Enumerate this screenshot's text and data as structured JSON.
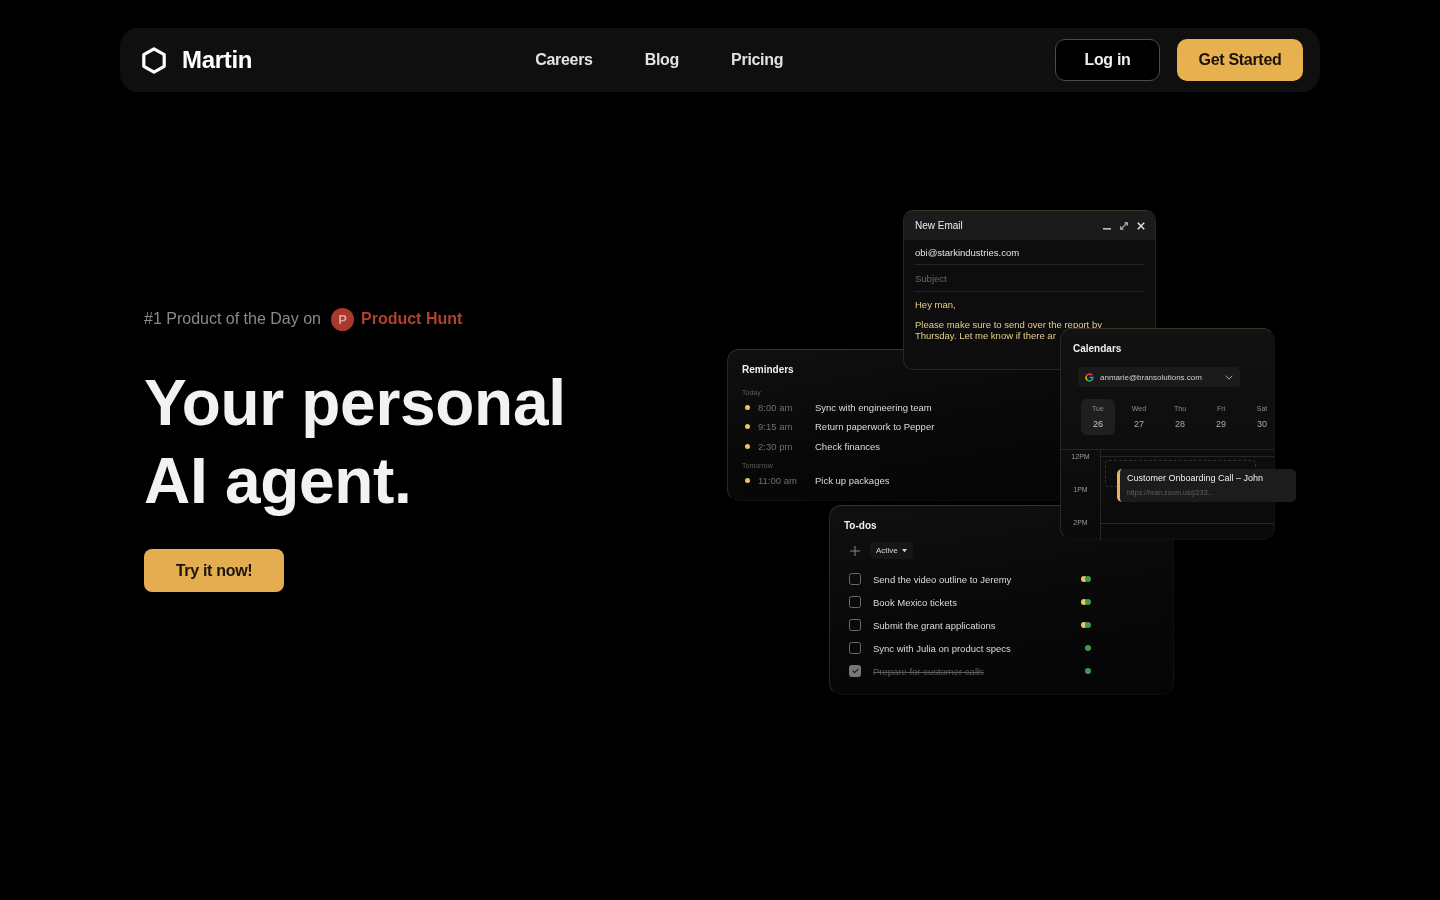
{
  "nav": {
    "brand": "Martin",
    "links": [
      {
        "label": "Careers"
      },
      {
        "label": "Blog"
      },
      {
        "label": "Pricing"
      }
    ],
    "buttons": [
      {
        "label": "Log in",
        "kind": "outline"
      },
      {
        "label": "Get Started",
        "kind": "primary"
      }
    ]
  },
  "hero": {
    "award": {
      "text": "#1 Product of the Day on",
      "logo_letter": "P",
      "name": "Product Hunt"
    },
    "title": "Your personal AI agent.",
    "cta": "Try it now!"
  },
  "email": {
    "title": "New Email",
    "to": {
      "value": "obi@starkindustries.com"
    },
    "subject": {
      "placeholder": "Subject"
    },
    "body": [
      "Hey man,",
      "Please make sure to send over the report by Thursday. Let me know if there ar"
    ]
  },
  "reminders": {
    "title": "Reminders",
    "groups": [
      {
        "label": "Today",
        "items": [
          {
            "time": "8:00 am",
            "text": "Sync with engineering team"
          },
          {
            "time": "9:15 am",
            "text": "Return paperwork to Pepper"
          },
          {
            "time": "2:30 pm",
            "text": "Check finances"
          }
        ]
      },
      {
        "label": "Tomorrow",
        "items": [
          {
            "time": "11:00 am",
            "text": "Pick up packages"
          }
        ]
      }
    ]
  },
  "calendar": {
    "title": "Calendars",
    "account": "anmarie@bransolutions.com",
    "days": [
      {
        "name": "Tue",
        "date": "26",
        "selected": true
      },
      {
        "name": "Wed",
        "date": "27",
        "selected": false
      },
      {
        "name": "Thu",
        "date": "28",
        "selected": false
      },
      {
        "name": "Fri",
        "date": "29",
        "selected": false
      },
      {
        "name": "Sat",
        "date": "30",
        "selected": false
      }
    ],
    "hours": [
      "12PM",
      "1PM",
      "2PM"
    ],
    "event": {
      "title": "Customer Onboarding Call – John",
      "link": "https://bran.zoom.us/j/233..."
    }
  },
  "todos": {
    "title": "To-dos",
    "filter": "Active",
    "items": [
      {
        "text": "Send the video outline to Jeremy",
        "checked": false,
        "dots": [
          {
            "color": "#e9c46a"
          },
          {
            "color": "#3d9a50"
          }
        ]
      },
      {
        "text": "Book Mexico tickets",
        "checked": false,
        "dots": [
          {
            "color": "#e9c46a"
          },
          {
            "color": "#3d9a50"
          }
        ]
      },
      {
        "text": "Submit the grant applications",
        "checked": false,
        "dots": [
          {
            "color": "#e9c46a"
          },
          {
            "color": "#3d9a50"
          }
        ]
      },
      {
        "text": "Sync with Julia on product specs",
        "checked": false,
        "dots": [
          {
            "color": "#3d9a50"
          }
        ]
      },
      {
        "text": "Prepare for customer calls",
        "checked": true,
        "dots": [
          {
            "color": "#3d9a50"
          }
        ]
      }
    ]
  }
}
